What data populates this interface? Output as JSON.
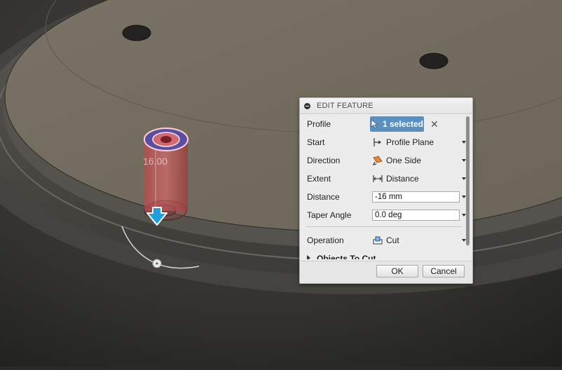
{
  "viewport": {
    "dimension_value": "16.00"
  },
  "dialog": {
    "title": "EDIT FEATURE",
    "profile": {
      "label": "Profile",
      "selection": "1 selected"
    },
    "start": {
      "label": "Start",
      "value": "Profile Plane"
    },
    "direction": {
      "label": "Direction",
      "value": "One Side"
    },
    "extent": {
      "label": "Extent",
      "value": "Distance"
    },
    "distance": {
      "label": "Distance",
      "value": "-16 mm"
    },
    "taper_angle": {
      "label": "Taper Angle",
      "value": "0.0 deg"
    },
    "operation": {
      "label": "Operation",
      "value": "Cut"
    },
    "objects_to_cut": {
      "label": "Objects To Cut"
    },
    "ok_label": "OK",
    "cancel_label": "Cancel"
  },
  "colors": {
    "selection_blue": "#5a8fc0",
    "cut_red": "#c8464a",
    "arrow_blue": "#1e9fe0"
  }
}
